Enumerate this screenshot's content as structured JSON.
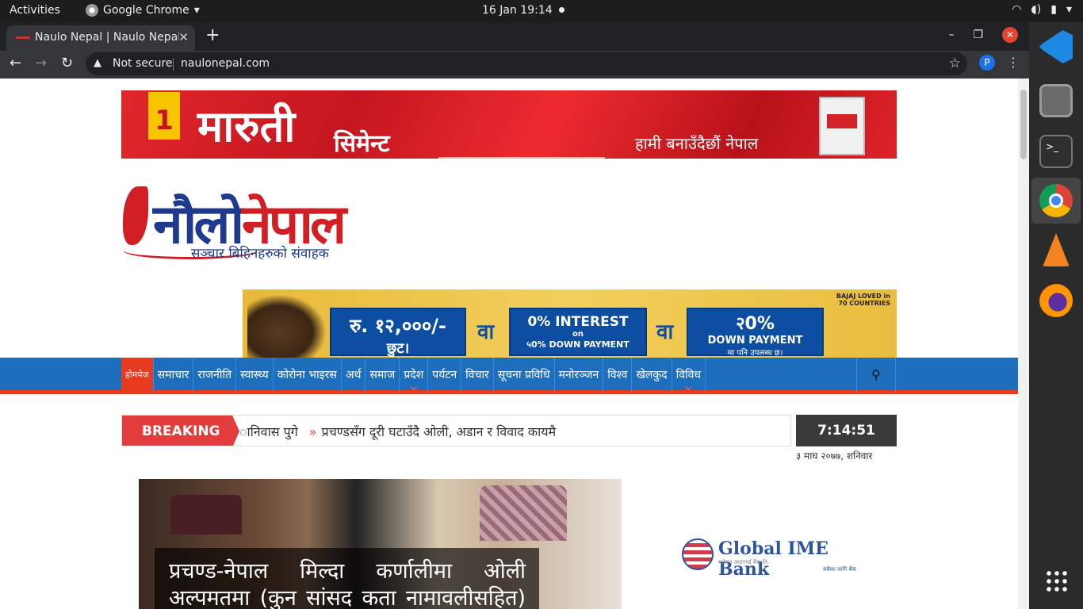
{
  "topbar": {
    "activities": "Activities",
    "app_name": "Google Chrome",
    "datetime": "16 Jan  19:14"
  },
  "browser": {
    "tab_title": "Naulo Nepal | Naulo Nepal",
    "not_secure": "Not secure",
    "url": "naulonepal.com",
    "profile_initial": "P"
  },
  "ads": {
    "top": {
      "badge": "1",
      "brand": "मारुती",
      "brand_sub": "सिमेन्ट",
      "tagline": "हामी बनाउँदैछौं नेपाल"
    },
    "bike": {
      "offer1_line1": "रु. १२,०००/-",
      "offer1_line2": "छुट।",
      "or1": "वा",
      "offer2_line1": "0% INTEREST",
      "offer2_line2": "on",
      "offer2_line3": "५0% DOWN PAYMENT",
      "or2": "वा",
      "offer3_line1": "२0%",
      "offer3_line2": "DOWN PAYMENT",
      "offer3_line3": "मा पनि उपलब्ध छ।",
      "brand": "BAJAJ  LOVED in 70 COUNTRIES"
    },
    "side": {
      "name": "Global IME Bank",
      "sub": "ग्लोबल आइएमई बैंक लि.",
      "tag": "सबैका लागि बैंक"
    }
  },
  "logo": {
    "word1": "नौलो",
    "word2": "नेपाल",
    "tagline": "सञ्चार बिहिनहरुको संवाहक"
  },
  "nav": {
    "items": [
      {
        "label": "होमपेज",
        "active": true
      },
      {
        "label": "समाचार"
      },
      {
        "label": "राजनीति"
      },
      {
        "label": "स्वास्थ्य"
      },
      {
        "label": "कोरोना भाइरस"
      },
      {
        "label": "अर्थ"
      },
      {
        "label": "समाज"
      },
      {
        "label": "प्रदेश",
        "dropdown": true
      },
      {
        "label": "पर्यटन"
      },
      {
        "label": "विचार"
      },
      {
        "label": "सूचना प्रविधि"
      },
      {
        "label": "मनोरञ्जन"
      },
      {
        "label": "विश्व"
      },
      {
        "label": "खेलकुद"
      },
      {
        "label": "विविध",
        "dropdown": true
      }
    ]
  },
  "breaking": {
    "label": "BREAKING",
    "ticker_prev": "ानिवास पुगे",
    "ticker_current": "प्रचण्डसँग दूरी घटाउँदै ओली, अडान र विवाद कायमै"
  },
  "clock": {
    "time": "7:14:51",
    "date": "३ माघ २०७७, शनिवार"
  },
  "hero": {
    "headline": "प्रचण्ड-नेपाल मिल्दा कर्णालीमा ओली अल्पमतमा (कुन सांसद कता नामावलीसहित)"
  }
}
